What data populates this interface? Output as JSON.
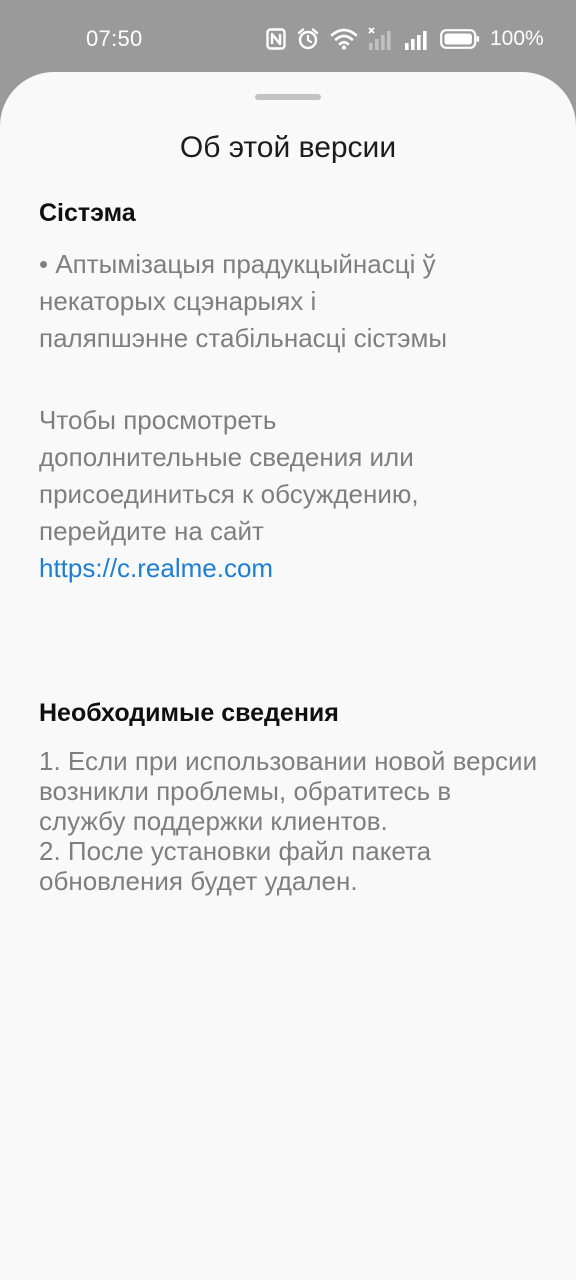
{
  "status_bar": {
    "time": "07:50",
    "battery_percent": "100%",
    "icons": [
      "nfc-icon",
      "alarm-icon",
      "wifi-icon",
      "signal-no-service-icon",
      "signal-icon",
      "battery-icon"
    ]
  },
  "sheet": {
    "title": "Об этой версии",
    "system": {
      "heading": "Сістэма",
      "lines": [
        "• Аптымізацыя прадукцыйнасці ў",
        "некаторых сцэнарыях і",
        "паляпшэнне стабільнасці сістэмы"
      ]
    },
    "info": {
      "lines": [
        "Чтобы просмотреть",
        "дополнительные сведения или",
        "присоединиться к обсуждению,",
        "перейдите на сайт"
      ],
      "link": "https://c.realme.com"
    },
    "required": {
      "heading": "Необходимые сведения",
      "items": [
        "1. Если при использовании новой версии возникли проблемы, обратитесь в службу поддержки клиентов.",
        "2. После установки файл пакета обновления будет удален."
      ]
    }
  }
}
